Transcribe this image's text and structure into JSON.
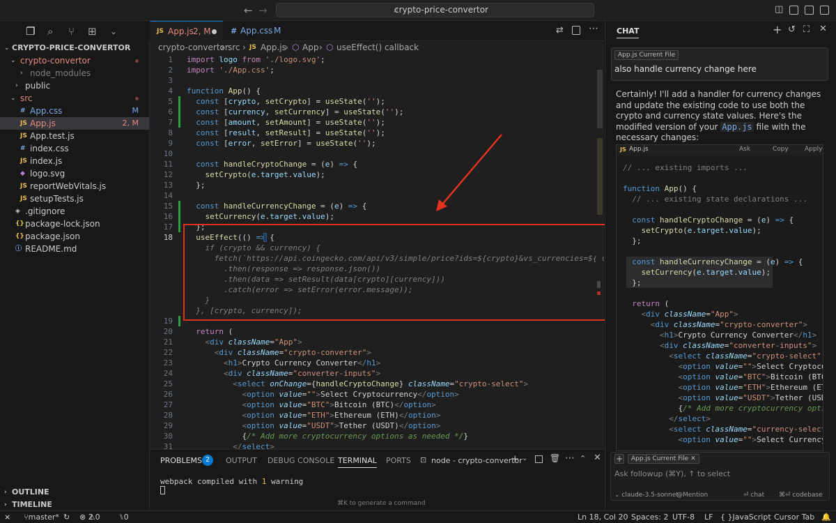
{
  "window": {
    "search_text": "crypto-price-convertor"
  },
  "explorer": {
    "root": "CRYPTO-PRICE-CONVERTOR",
    "items": [
      {
        "label": "crypto-convertor",
        "type": "folder",
        "color": "#e8897d"
      },
      {
        "label": "node_modules",
        "type": "folder",
        "color": "#7f7f7f"
      },
      {
        "label": "public",
        "type": "folder",
        "color": "#cccccc"
      },
      {
        "label": "src",
        "type": "folder",
        "color": "#e8897d"
      },
      {
        "label": "App.css",
        "type": "css",
        "color": "#7aa7e5",
        "status": "M"
      },
      {
        "label": "App.js",
        "type": "js",
        "color": "#e8897d",
        "status": "2, M"
      },
      {
        "label": "App.test.js",
        "type": "js",
        "color": "#cccccc"
      },
      {
        "label": "index.css",
        "type": "css",
        "color": "#cccccc"
      },
      {
        "label": "index.js",
        "type": "js",
        "color": "#cccccc"
      },
      {
        "label": "logo.svg",
        "type": "svg",
        "color": "#cccccc"
      },
      {
        "label": "reportWebVitals.js",
        "type": "js",
        "color": "#cccccc"
      },
      {
        "label": "setupTests.js",
        "type": "js",
        "color": "#cccccc"
      },
      {
        "label": ".gitignore",
        "type": "git",
        "color": "#cccccc"
      },
      {
        "label": "package-lock.json",
        "type": "json",
        "color": "#cccccc"
      },
      {
        "label": "package.json",
        "type": "json",
        "color": "#cccccc"
      },
      {
        "label": "README.md",
        "type": "md",
        "color": "#cccccc"
      }
    ],
    "outline": "OUTLINE",
    "timeline": "TIMELINE"
  },
  "tabs": [
    {
      "icon": "JS",
      "label": "App.js",
      "status": "2, M",
      "color": "#e8897d"
    },
    {
      "icon": "#",
      "label": "App.css",
      "status": "M",
      "color": "#7aa7e5"
    }
  ],
  "breadcrumb": [
    "crypto-convertor",
    "src",
    "App.js",
    "App",
    "useEffect() callback"
  ],
  "panel": {
    "tabs": [
      "PROBLEMS",
      "OUTPUT",
      "DEBUG CONSOLE",
      "TERMINAL",
      "PORTS"
    ],
    "problems_count": "2",
    "terminal_name": "node - crypto-convertor",
    "output_line": "webpack compiled with ",
    "output_num": "1",
    "output_tail": " warning",
    "hint": "⌘K to generate a command"
  },
  "chat": {
    "title": "CHAT",
    "context_pill": "App.js  Current File",
    "user_message": "also handle currency change here",
    "response_part1": "Certainly! I'll add a handler for currency changes and update the existing code to use both the crypto and currency state values. Here's the modified version of your ",
    "response_file": "App.js",
    "response_part2": " file with the necessary changes:",
    "code_file": "App.js",
    "code_actions": [
      "Ask",
      "Copy",
      "Apply"
    ],
    "input_pill": "App.js  Current File",
    "input_placeholder": "Ask followup (⌘Y), ↑ to select",
    "model": "claude-3.5-sonnet",
    "mention": "@Mention",
    "chat_btn": "⏎ chat",
    "codebase_btn": "⌘⏎ codebase"
  },
  "status": {
    "branch": "master*",
    "errors": "2",
    "warnings": "0",
    "ports": "0",
    "position": "Ln 18, Col 20",
    "spaces": "Spaces: 2",
    "encoding": "UTF-8",
    "eol": "LF",
    "language": "JavaScript",
    "tab_mode": "Cursor Tab"
  },
  "colors": {
    "accent": "#0078d4",
    "annotation": "#e0321f"
  }
}
